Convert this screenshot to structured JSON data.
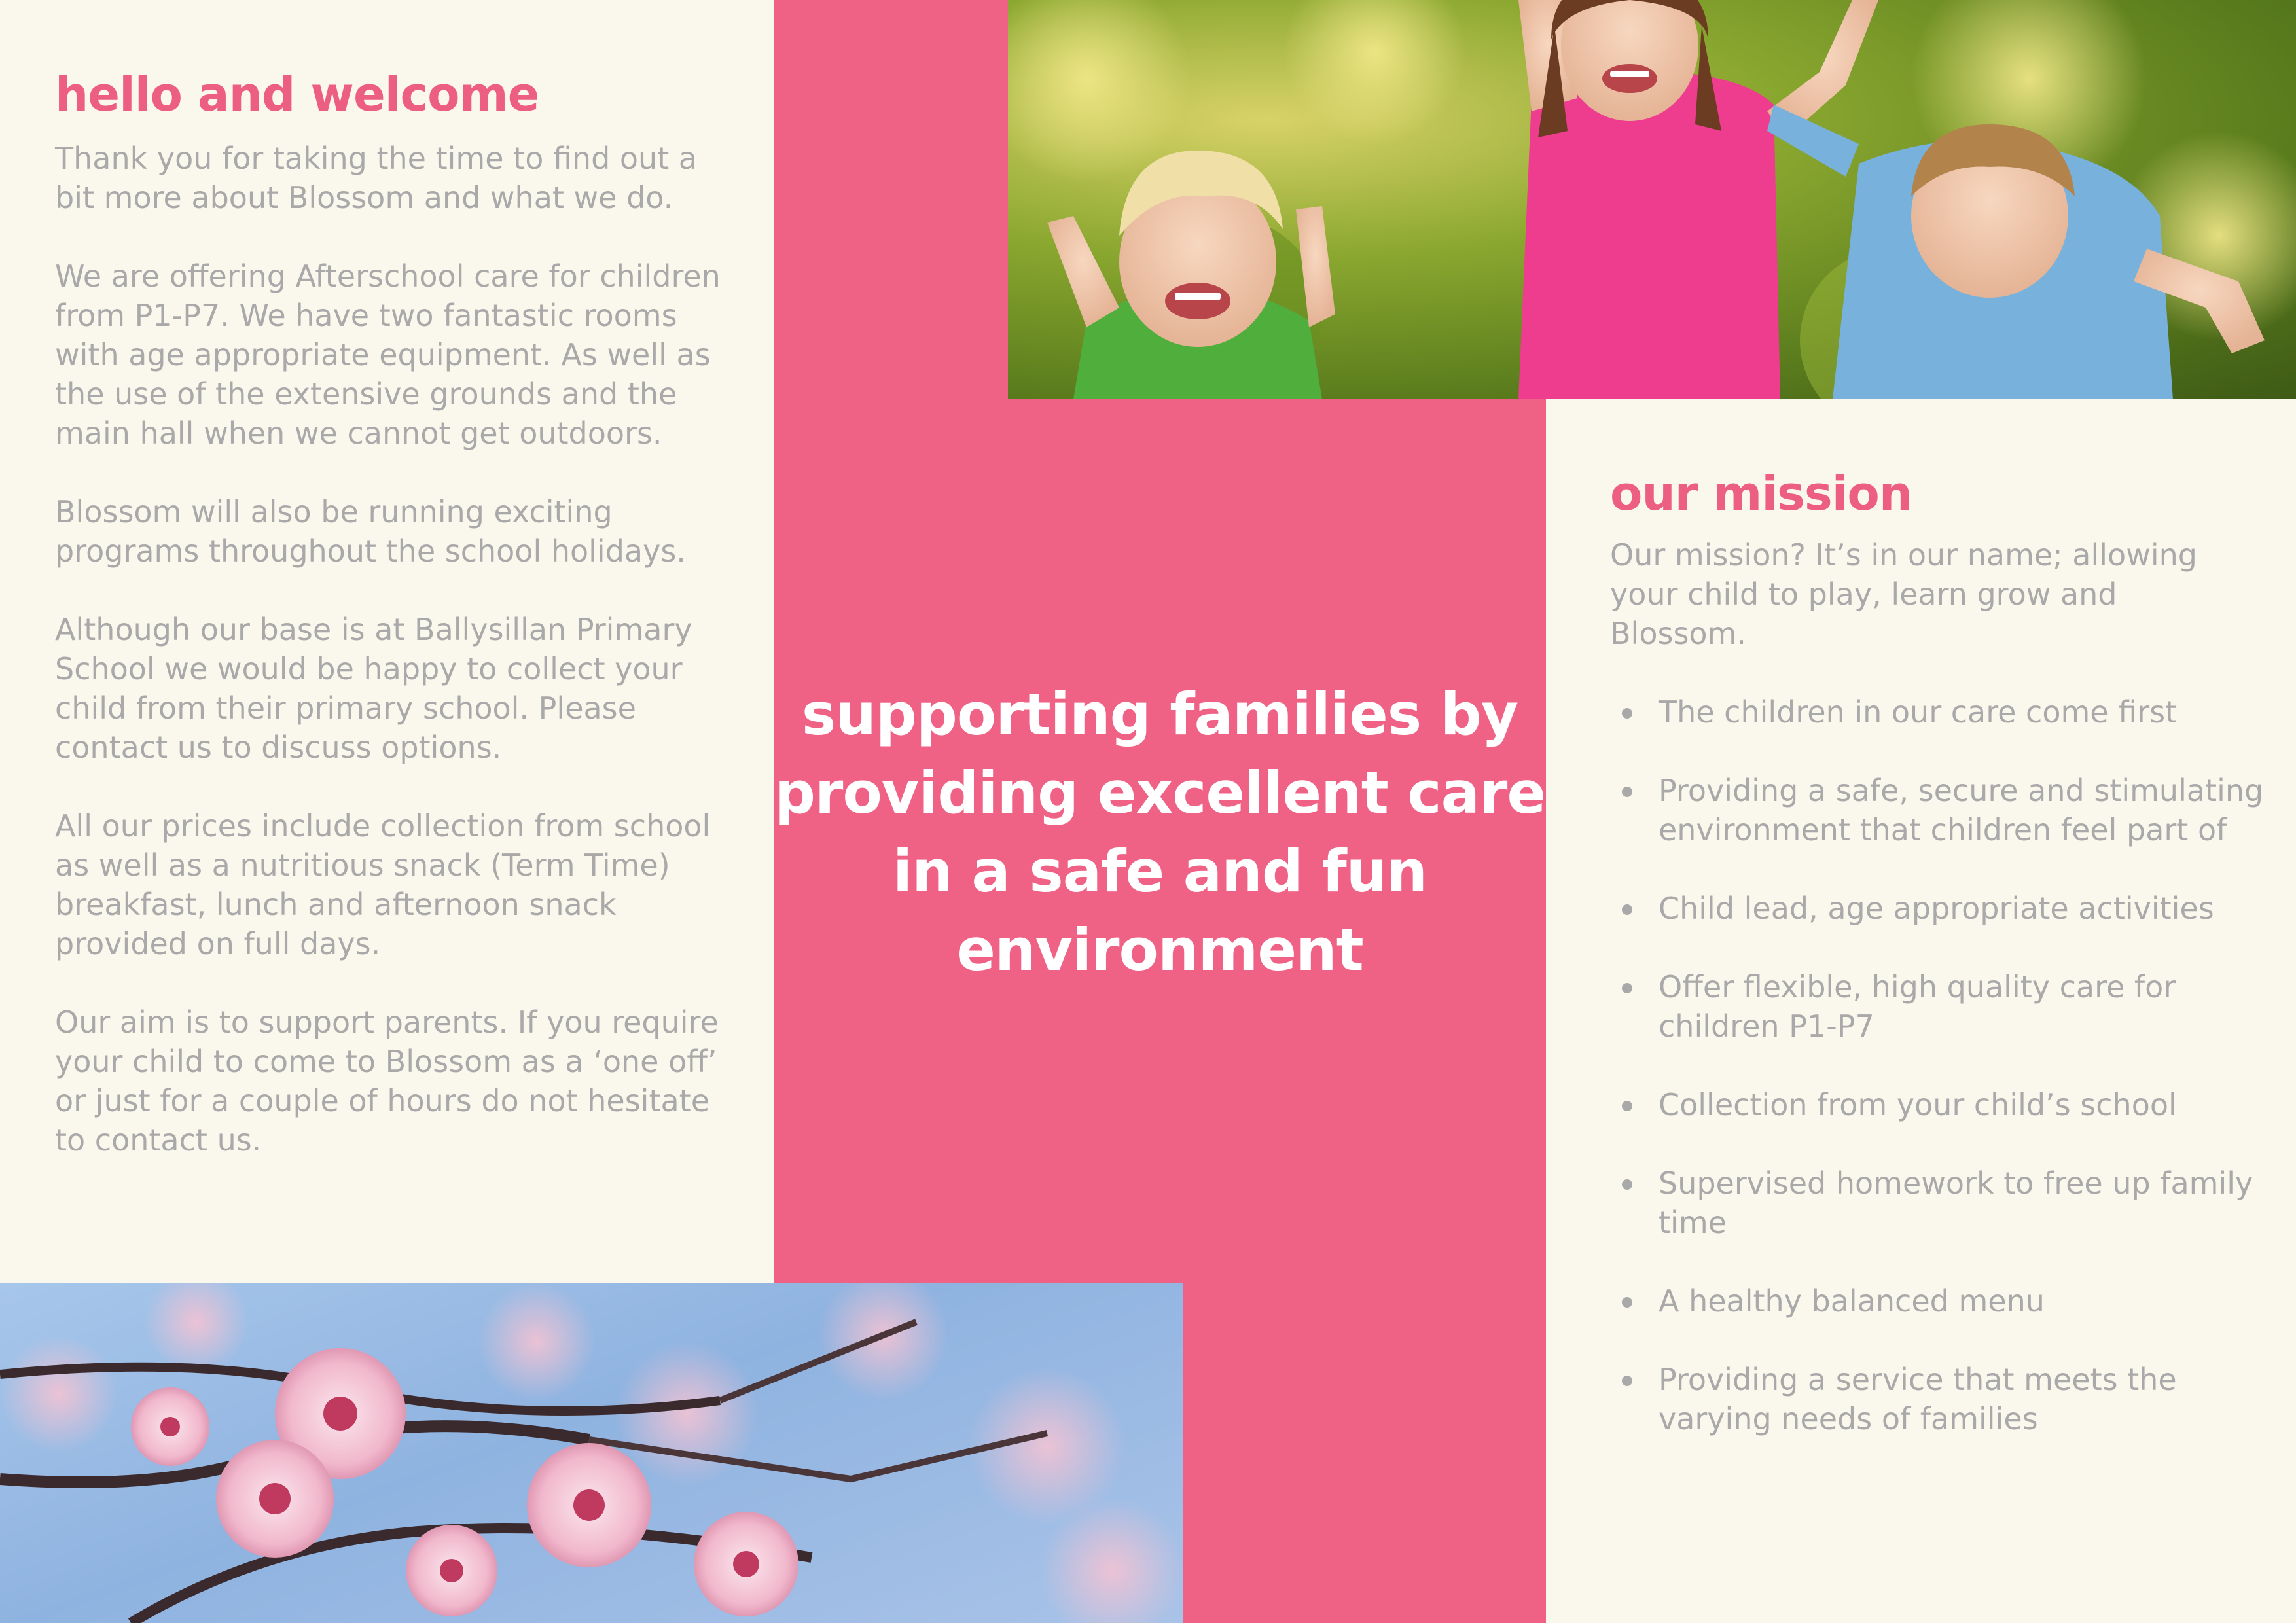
{
  "left": {
    "heading": "hello and welcome",
    "paragraphs": [
      "Thank you for taking the time to find out a bit more about Blossom and what we do.",
      "We are offering Afterschool care for children from P1-P7. We have two fantastic rooms with age appropriate equipment. As well as the use of the extensive grounds and the main hall when we cannot get outdoors.",
      "Blossom will also be running exciting programs throughout the school holidays.",
      "Although our base is at Ballysillan Primary School we would be happy to collect your child from their primary school. Please contact us to discuss options.",
      "All our prices include collection from school as well as a nutritious snack (Term Time) breakfast, lunch and afternoon snack provided on full days.",
      "Our aim is to support parents. If you require your child to come to Blossom as a ‘one off’ or just for a couple of hours do not hesitate to contact us."
    ]
  },
  "center": {
    "tagline": "supporting families by providing excellent care in a safe and fun environment"
  },
  "mission": {
    "heading": "our mission",
    "intro": "Our mission? It’s in our name; allowing your child to play, learn grow and Blossom.",
    "items": [
      "The children in our care come first",
      "Providing a safe, secure and stimulating environment that children feel part of",
      "Child lead, age appropriate activities",
      "Offer flexible, high quality  care for children P1-P7",
      "Collection from your child’s school",
      "Supervised homework to free up family time",
      "A healthy balanced menu",
      "Providing a service that meets the varying needs of families"
    ]
  },
  "colors": {
    "pink": "#f06285",
    "heading_pink": "#ec5f83",
    "cream": "#faf7ec",
    "body_grey": "#a9a9a9"
  }
}
